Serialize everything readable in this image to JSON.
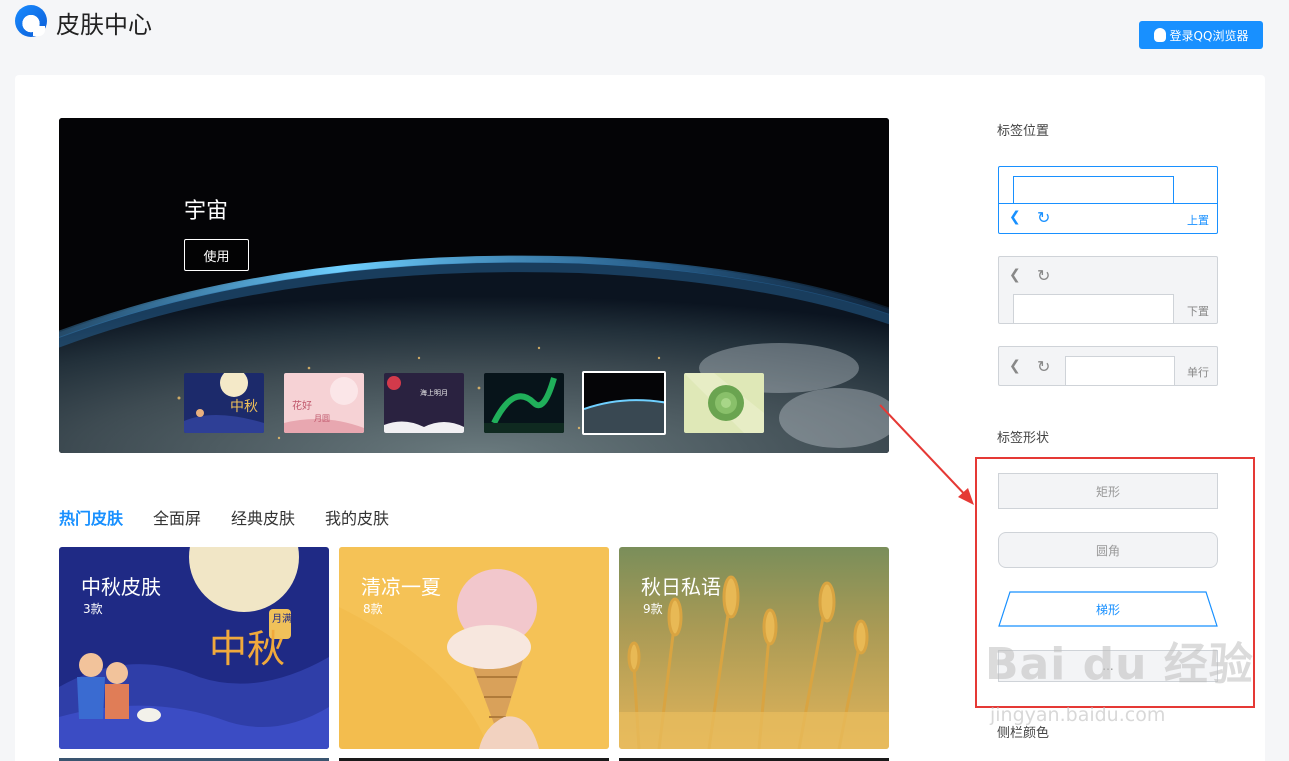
{
  "header": {
    "title": "皮肤中心",
    "login_label": "登录QQ浏览器"
  },
  "banner": {
    "title": "宇宙",
    "use_label": "使用",
    "thumbnails": [
      {
        "name": "mid-autumn",
        "text": "中秋"
      },
      {
        "name": "flower-moon",
        "text": "花好 月圆"
      },
      {
        "name": "moon-night",
        "text": ""
      },
      {
        "name": "aurora",
        "text": ""
      },
      {
        "name": "earth-space",
        "text": "",
        "active": true
      },
      {
        "name": "succulent",
        "text": ""
      }
    ]
  },
  "tabs": [
    {
      "label": "热门皮肤",
      "active": true
    },
    {
      "label": "全面屏"
    },
    {
      "label": "经典皮肤"
    },
    {
      "label": "我的皮肤"
    }
  ],
  "cards": [
    {
      "title": "中秋皮肤",
      "count": "3款",
      "art_text": "中秋",
      "badge": "月满"
    },
    {
      "title": "清凉一夏",
      "count": "8款"
    },
    {
      "title": "秋日私语",
      "count": "9款"
    }
  ],
  "settings": {
    "tab_position_label": "标签位置",
    "positions": [
      {
        "label": "上置",
        "active": true
      },
      {
        "label": "下置"
      },
      {
        "label": "单行"
      }
    ],
    "tab_shape_label": "标签形状",
    "shapes": [
      {
        "label": "矩形"
      },
      {
        "label": "圆角"
      },
      {
        "label": "梯形",
        "active": true
      },
      {
        "label": "..."
      }
    ],
    "sidebar_color_label": "侧栏颜色"
  },
  "watermark": {
    "text": "Bai du 经验",
    "sub": "jingyan.baidu.com"
  },
  "colors": {
    "accent": "#1890ff",
    "highlight": "#e53935"
  }
}
